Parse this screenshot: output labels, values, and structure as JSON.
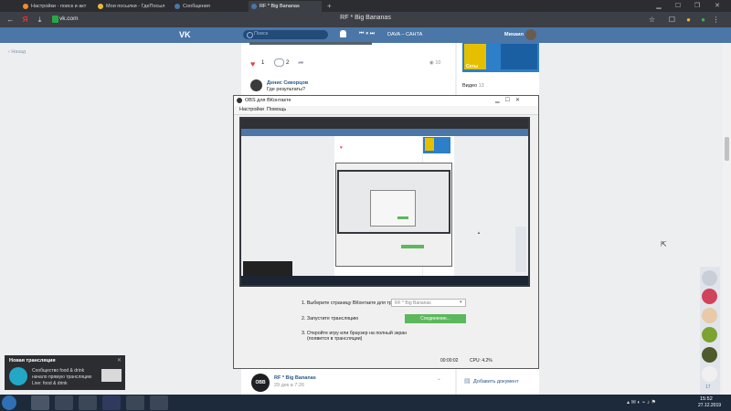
{
  "browser": {
    "tabs": [
      {
        "label": "Настройки - поиск и акт"
      },
      {
        "label": "Мои посылки - ГдеПосыл"
      },
      {
        "label": "Сообщения"
      },
      {
        "label": "RF * Big Bananas"
      }
    ],
    "url": "vk.com",
    "page_title": "RF * Big Bananas",
    "nav_letter": "Я"
  },
  "vk": {
    "logo": "VK",
    "search_placeholder": "Поиск",
    "player_controls": "⏮ ⏸ ⏭",
    "now_playing": "DAVA – САНТА",
    "username": "Михаил",
    "back_link": "Назад",
    "post": {
      "likes": "1",
      "comments": "2",
      "views": "10"
    },
    "comment": {
      "author": "Денис Скворцов",
      "text": "Где результаты?"
    },
    "ad_label": "Сеты",
    "video_label": "Видео",
    "video_count": "13",
    "add_document": "Добавить документ",
    "bottom_post": {
      "avatar_text": "OBB",
      "author": "RF * Big Bananas",
      "date": "29 дек в 7:26"
    },
    "chat_count": "17"
  },
  "obs": {
    "title": "OBS для ВКонтакте",
    "menu": [
      "Настройки",
      "Помощь"
    ],
    "step1": "1. Выберите страницу ВКонтакте для трансляции",
    "step1_value": "RF * Big Bananas",
    "step2": "2. Запустите трансляцию",
    "connect_label": "Соединение...",
    "step3_l1": "3. Откройте игру или браузер на полный экран",
    "step3_l2": "(появится в трансляции)",
    "time": "00:00:02",
    "cpu": "CPU: 4.2%"
  },
  "live_notification": {
    "title": "Новая трансляция",
    "line1": "Сообщество food & drink",
    "line2": "начало прямую трансляцию",
    "line3": "Live: food & drink"
  },
  "taskbar": {
    "time": "15:52",
    "date": "27.12.2019"
  }
}
